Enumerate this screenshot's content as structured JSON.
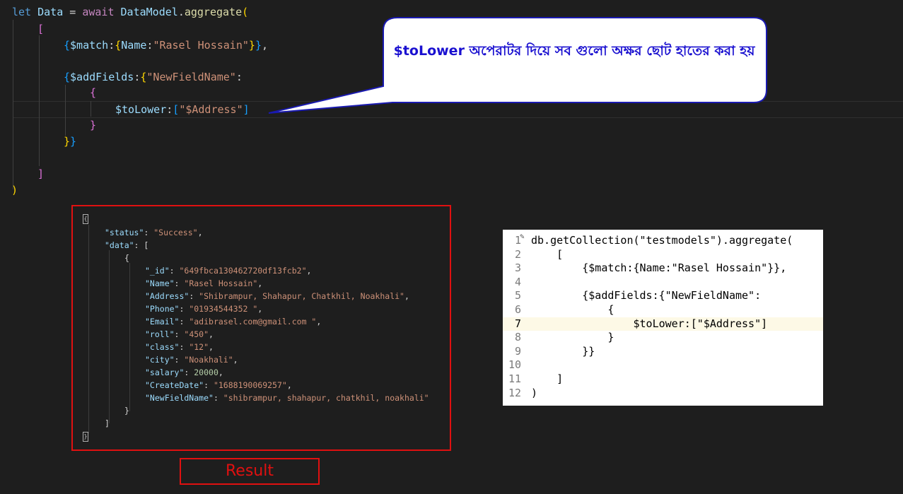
{
  "editor": {
    "line1": {
      "let": "let",
      "name": "Data",
      "eq": " = ",
      "await": "await",
      "model": "DataModel",
      "method": "aggregate",
      "paren": "("
    },
    "match_key": "$match",
    "match_field": "Name",
    "match_value": "\"Rasel Hossain\"",
    "addfields_key": "$addFields",
    "newfield_name": "\"NewFieldName\"",
    "tolower_key": "$toLower",
    "tolower_value": "\"$Address\""
  },
  "callout": {
    "text": "$toLower অপেরাটর দিয়ে সব গুলো অক্ষর ছোট হাতের করা হয়"
  },
  "result": {
    "label": "Result",
    "status_key": "\"status\"",
    "status_value": "\"Success\"",
    "data_key": "\"data\"",
    "fields": [
      {
        "key": "\"_id\"",
        "value": "\"649fbca130462720df13fcb2\"",
        "type": "str"
      },
      {
        "key": "\"Name\"",
        "value": "\"Rasel Hossain\"",
        "type": "str"
      },
      {
        "key": "\"Address\"",
        "value": "\"Shibrampur, Shahapur, Chatkhil, Noakhali\"",
        "type": "str"
      },
      {
        "key": "\"Phone\"",
        "value": "\"01934544352 \"",
        "type": "str"
      },
      {
        "key": "\"Email\"",
        "value": "\"adibrasel.com@gmail.com \"",
        "type": "str"
      },
      {
        "key": "\"roll\"",
        "value": "\"450\"",
        "type": "str"
      },
      {
        "key": "\"class\"",
        "value": "\"12\"",
        "type": "str"
      },
      {
        "key": "\"city\"",
        "value": "\"Noakhali\"",
        "type": "str"
      },
      {
        "key": "\"salary\"",
        "value": "20000",
        "type": "num"
      },
      {
        "key": "\"CreateDate\"",
        "value": "\"1688190069257\"",
        "type": "str"
      },
      {
        "key": "\"NewFieldName\"",
        "value": "\"shibrampur, shahapur, chatkhil, noakhali\"",
        "type": "str",
        "last": true
      }
    ]
  },
  "mongo": {
    "lines": [
      {
        "num": "1",
        "code": "db.getCollection(\"testmodels\").aggregate("
      },
      {
        "num": "2",
        "code": "    ["
      },
      {
        "num": "3",
        "code": "        {$match:{Name:\"Rasel Hossain\"}},"
      },
      {
        "num": "4",
        "code": ""
      },
      {
        "num": "5",
        "code": "        {$addFields:{\"NewFieldName\":"
      },
      {
        "num": "6",
        "code": "            {"
      },
      {
        "num": "7",
        "code": "                $toLower:[\"$Address\"]"
      },
      {
        "num": "8",
        "code": "            }"
      },
      {
        "num": "9",
        "code": "        }}"
      },
      {
        "num": "10",
        "code": ""
      },
      {
        "num": "11",
        "code": "    ]"
      },
      {
        "num": "12",
        "code": ")"
      }
    ]
  }
}
